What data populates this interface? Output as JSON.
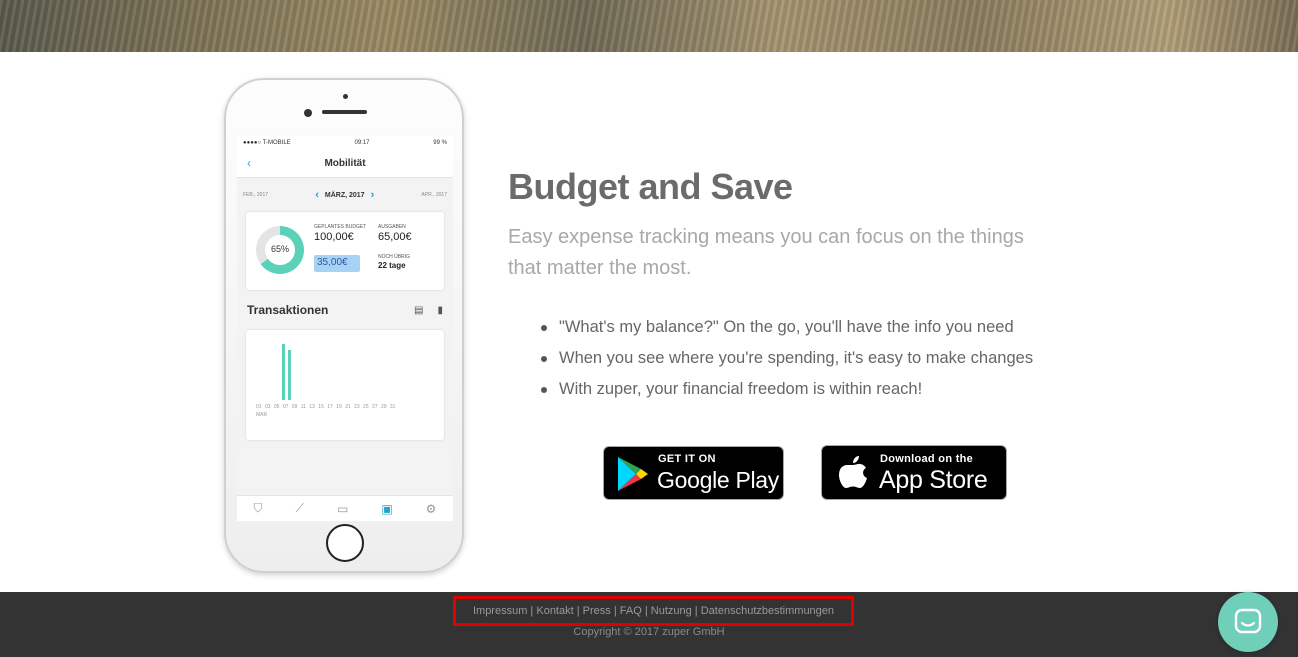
{
  "phone": {
    "status_carrier": "●●●●○ T-MOBILE",
    "status_time": "09:17",
    "status_battery": "99 %",
    "nav_back": "‹",
    "nav_title": "Mobilität",
    "month_prev": "FEB., 2017",
    "month_current": "MÄRZ, 2017",
    "month_next": "APR., 2017",
    "budget": {
      "percent": "65%",
      "percent_value": 0.65,
      "planned_label": "GEPLANTES BUDGET",
      "planned_value": "100,00€",
      "expenses_label": "AUSGABEN",
      "expenses_value": "65,00€",
      "remaining_value": "35,00€",
      "remaining_label": "NOCH ÜBRIG",
      "days_value": "22 tage"
    },
    "transactions_title": "Transaktionen",
    "chart_ticks": "01 03 05 07 09 11 13 15 17 19 21 23 25 27 29 31",
    "chart_month": "MAR",
    "chart_bars": [
      {
        "day": 5,
        "value": 1.0
      },
      {
        "day": 6,
        "value": 0.9
      }
    ],
    "tab_icons": [
      "shield-icon",
      "trend-icon",
      "laptop-icon",
      "wallet-icon",
      "gear-icon"
    ]
  },
  "content": {
    "headline": "Budget and Save",
    "subline": "Easy expense tracking means you can focus on the things that matter the most.",
    "bullets": [
      "\"What's my balance?\" On the go, you'll have the info you need",
      "When you see where you're spending, it's easy to make changes",
      "With zuper, your financial freedom is within reach!"
    ]
  },
  "stores": {
    "google_small": "GET IT ON",
    "google_big": "Google Play",
    "apple_small": "Download on the",
    "apple_big": "App Store"
  },
  "footer": {
    "links": [
      "Impressum",
      "Kontakt",
      "Press",
      "FAQ",
      "Nutzung",
      "Datenschutzbestimmungen"
    ],
    "separator": " | ",
    "copyright": "Copyright © 2017 zuper GmbH"
  },
  "colors": {
    "accent": "#21a6c9",
    "teal": "#5ad1b8",
    "footer_bg": "#333333",
    "highlight_border": "#e00000",
    "chat_button": "#6fcfb9"
  }
}
